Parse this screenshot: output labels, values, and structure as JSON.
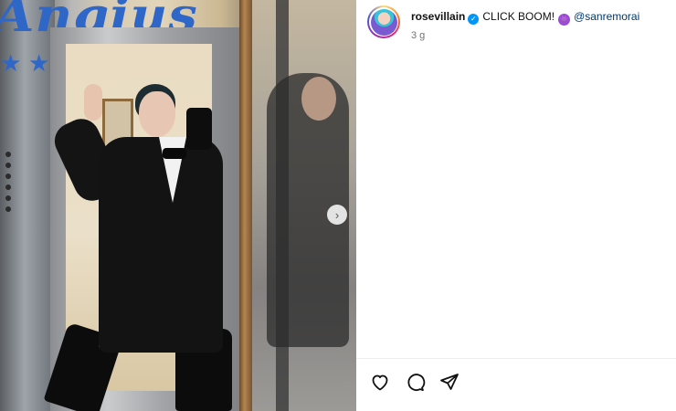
{
  "post": {
    "username": "rosevillain",
    "caption": "CLICK BOOM!",
    "mention": "@sanremorai",
    "time": "3 g"
  },
  "photo": {
    "sign_text": "Angius",
    "next_icon": "chevron-right-icon"
  },
  "actions": {
    "like_icon": "heart-icon",
    "comment_icon": "comment-icon",
    "share_icon": "share-icon"
  },
  "colors": {
    "link": "#00376b",
    "verified": "#0095f6",
    "timestamp": "#737373"
  }
}
